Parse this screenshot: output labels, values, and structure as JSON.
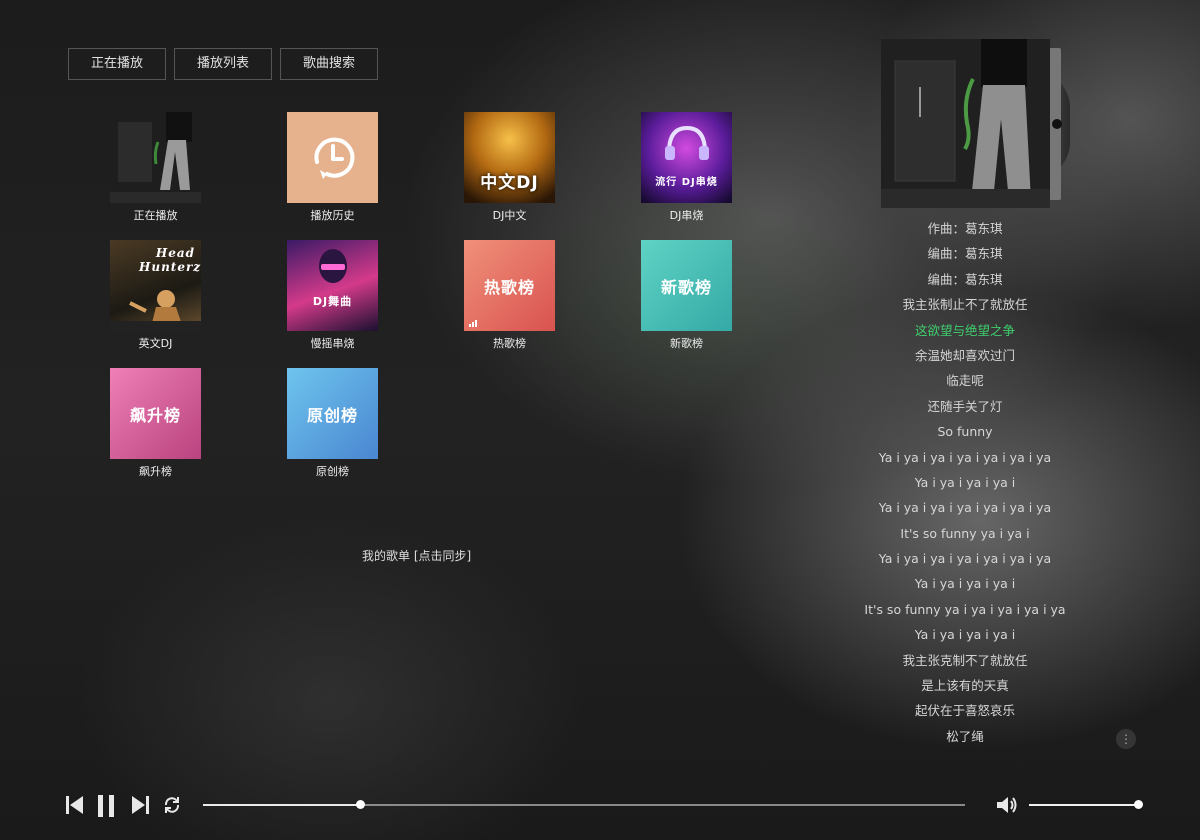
{
  "nav": {
    "tabs": [
      {
        "label": "正在播放"
      },
      {
        "label": "播放列表"
      },
      {
        "label": "歌曲搜索"
      }
    ]
  },
  "grid": {
    "items": [
      {
        "label": "正在播放",
        "cover_text": ""
      },
      {
        "label": "播放历史",
        "cover_text": ""
      },
      {
        "label": "DJ中文",
        "cover_text": "中文DJ"
      },
      {
        "label": "DJ串烧",
        "cover_text": "流行 DJ串烧"
      },
      {
        "label": "英文DJ",
        "cover_text": "Head Hunterz"
      },
      {
        "label": "慢摇串烧",
        "cover_text": "DJ舞曲"
      },
      {
        "label": "热歌榜",
        "cover_text": "热歌榜"
      },
      {
        "label": "新歌榜",
        "cover_text": "新歌榜"
      },
      {
        "label": "飙升榜",
        "cover_text": "飙升榜"
      },
      {
        "label": "原创榜",
        "cover_text": "原创榜"
      }
    ]
  },
  "playlist": {
    "sync_text": "我的歌单 [点击同步]"
  },
  "lyrics": {
    "active_index": 4,
    "lines": [
      "作曲：葛东琪",
      "编曲：葛东琪",
      "编曲：葛东琪",
      "我主张制止不了就放任",
      "这欲望与绝望之争",
      "余温她却喜欢过门",
      "临走呢",
      "还随手关了灯",
      "So funny",
      "Ya i ya i ya i ya i ya i ya i ya",
      "Ya i ya i ya i ya i",
      "Ya i ya i ya i ya i ya i ya i ya",
      "It's so funny ya i ya i",
      "Ya i ya i ya i ya i ya i ya i ya",
      "Ya i ya i ya i ya i",
      "It's so funny ya i ya i ya i ya i ya",
      "Ya i ya i ya i ya i",
      "我主张克制不了就放任",
      "是上该有的天真",
      "起伏在于喜怒哀乐",
      "松了绳"
    ]
  },
  "player": {
    "progress": 0.206,
    "volume": 1.0,
    "icons": {
      "prev": "skip-previous-icon",
      "pause": "pause-icon",
      "next": "skip-next-icon",
      "repeat": "repeat-icon",
      "volume": "volume-icon",
      "more": "more-vertical-icon"
    }
  }
}
